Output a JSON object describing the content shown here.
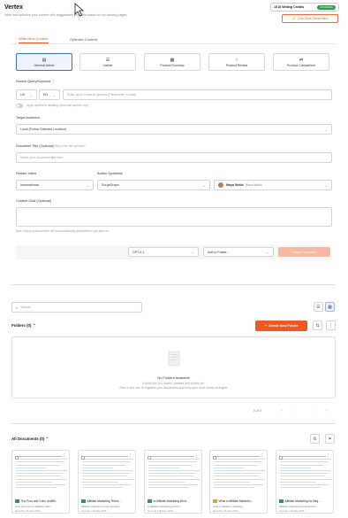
{
  "header": {
    "title": "Vertex",
    "subtitle": "Write and optimize your content with suggestions provided based on top-ranking pages",
    "credits_count": "18 AI Writing Credits",
    "credits_badge": "UPGRADE",
    "one_click_label": "One-Click Generation"
  },
  "tabs": [
    {
      "label": "Write New Content",
      "active": true
    },
    {
      "label": "Optimize Content",
      "active": false
    }
  ],
  "content_types": [
    {
      "label": "General Article",
      "icon": "document-icon",
      "selected": true
    },
    {
      "label": "Listicle",
      "icon": "list-icon",
      "selected": false
    },
    {
      "label": "Product Roundup",
      "icon": "grid-icon",
      "selected": false
    },
    {
      "label": "Product Review",
      "icon": "star-icon",
      "selected": false
    },
    {
      "label": "Product Comparison",
      "icon": "compare-icon",
      "selected": false
    }
  ],
  "form": {
    "keyword_label": "Search Query/Keyword",
    "country_value": "US",
    "language_value": "EN",
    "keyword_placeholder": "Enter up to 3 search queries (Press enter to add)",
    "apply_headings_label": "Apply queries to headings (short-tail queries only)",
    "target_audience_label": "Target Audience",
    "target_audience_value": "Local (Follow Selected Location)",
    "doc_title_label": "Document Title (Optional)",
    "doc_title_hint": "Why is the title optional?",
    "doc_title_placeholder": "Insert your document title here",
    "reader_intent_label": "Reader Intent",
    "reader_intent_value": "Informational",
    "author_synthesis_label": "Author Synthesis",
    "author_synthesis_value": "SurgeGraph",
    "author_name": "Maya Webb",
    "author_name_sub": "(Maya Webb)",
    "content_goal_label": "Content Goal (Optional)",
    "note": "Note: Empty optional fields will be automatically generated for you later on.",
    "model_value": "GPT-4.1",
    "folder_value": "Add to Folder...",
    "create_label": "Create Document"
  },
  "library": {
    "search_placeholder": "Search",
    "folders_title": "Folders (0)",
    "new_folder_label": "Create New Folder",
    "empty_title": "No Folders Available",
    "empty_desc_1": "It looks like you haven't created any folders yet.",
    "empty_desc_2": "Start a new one to organize your documents and keep your work neatly arranged.",
    "pager_text": "0 of 0",
    "docs_title": "All Documents (0)"
  },
  "documents": [
    {
      "title": "The Pros and Cons of Affili...",
      "sub": "pros and cons of affiliate mark...",
      "meta": "General | 18 May 2025",
      "flag": "#2e9a4e"
    },
    {
      "title": "Affiliate Marketing Terms ...",
      "sub": "affiliate marketing terms glossary",
      "meta": "General | 18 May 2025",
      "flag": "#2e9a4e"
    },
    {
      "title": "Is Affiliate Marketing Wort...",
      "sub": "is affiliate marketing worth it",
      "meta": "General | 18 May 2025",
      "flag": "#2e9a4e"
    },
    {
      "title": "What is Affiliate Marketin...",
      "sub": "what is affiliate marketing",
      "meta": "General | 18 May 2025",
      "flag": "#e2a12a"
    },
    {
      "title": "Affiliate Marketing for Beg...",
      "sub": "affiliate marketing for beginners",
      "meta": "General | 18 May 2025",
      "flag": "#2e9a4e"
    }
  ],
  "colors": {
    "accent": "#ef5a24",
    "selected": "#3b6fc8"
  }
}
